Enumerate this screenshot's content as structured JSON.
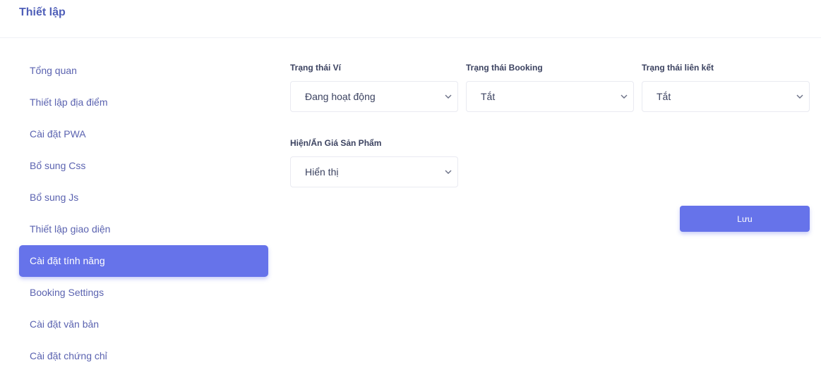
{
  "header": {
    "title": "Thiết lập"
  },
  "sidebar": {
    "items": [
      {
        "label": "Tổng quan"
      },
      {
        "label": "Thiết lập địa điểm"
      },
      {
        "label": "Cài đặt PWA"
      },
      {
        "label": "Bổ sung Css"
      },
      {
        "label": "Bổ sung Js"
      },
      {
        "label": "Thiết lập giao diện"
      },
      {
        "label": "Cài đặt tính năng",
        "active": true
      },
      {
        "label": "Booking Settings"
      },
      {
        "label": "Cài đặt văn bản"
      },
      {
        "label": "Cài đặt chứng chỉ"
      }
    ]
  },
  "form": {
    "wallet_status": {
      "label": "Trạng thái Ví",
      "value": "Đang hoạt động"
    },
    "booking_status": {
      "label": "Trạng thái Booking",
      "value": "Tắt"
    },
    "link_status": {
      "label": "Trạng thái liên kết",
      "value": "Tắt"
    },
    "price_visibility": {
      "label": "Hiện/Ẩn Giá Sản Phẩm",
      "value": "Hiển thị"
    },
    "save_label": "Lưu"
  },
  "colors": {
    "accent": "#6673ea",
    "sidebar_text": "#5b63b0",
    "title": "#4f5fb8"
  }
}
